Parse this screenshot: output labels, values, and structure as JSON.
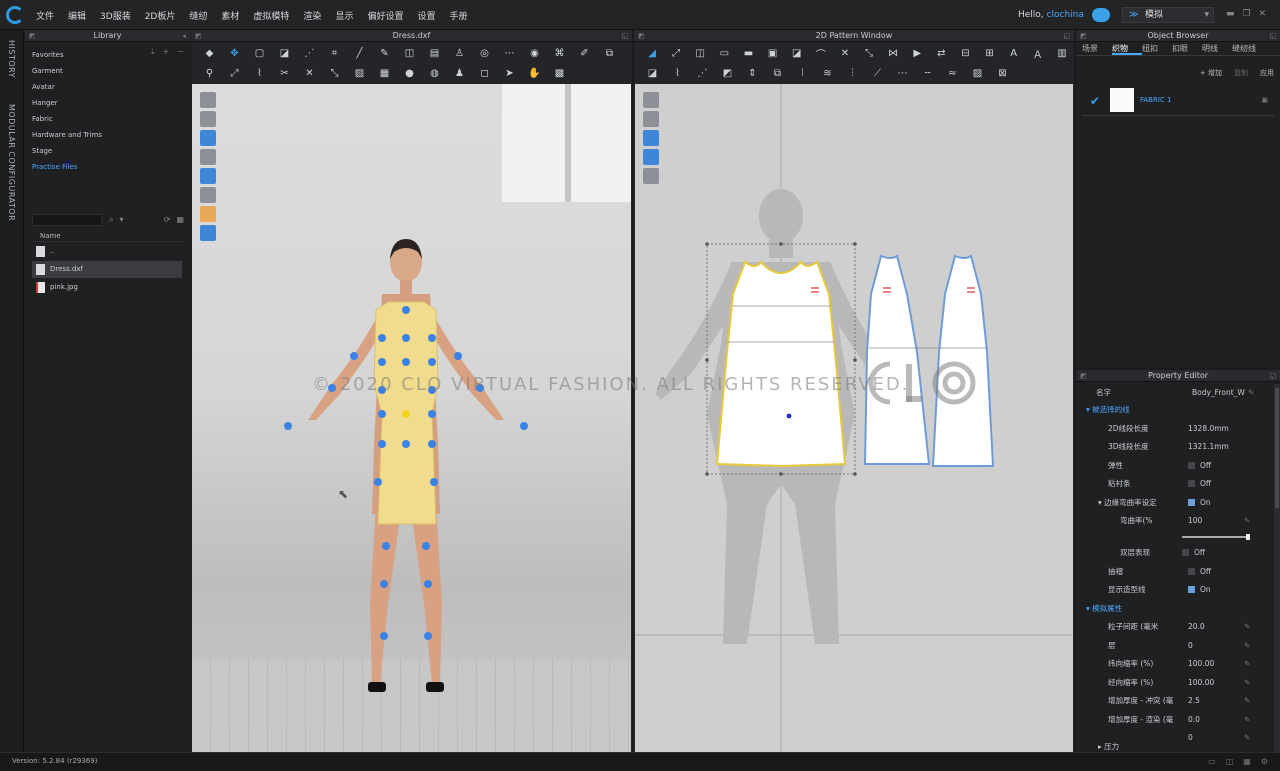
{
  "menu": [
    "文件",
    "编辑",
    "3D服装",
    "2D板片",
    "缝纫",
    "素材",
    "虚拟模特",
    "渲染",
    "显示",
    "偏好设置",
    "设置",
    "手册"
  ],
  "user": {
    "greeting": "Hello,",
    "name": "clochina"
  },
  "mode": "模拟",
  "vertical_tabs": [
    "HISTORY",
    "MODULAR CONFIGURATOR"
  ],
  "library": {
    "title": "Library",
    "categories": [
      "Favorites",
      "Garment",
      "Avatar",
      "Hanger",
      "Fabric",
      "Hardware and Trims",
      "Stage",
      "Practise Files"
    ],
    "active_category": "Practise Files",
    "column_header": "Name",
    "files": [
      "..",
      "Dress.dxf",
      "pink.jpg"
    ]
  },
  "window3d": {
    "title": "Dress.dxf"
  },
  "window2d": {
    "title": "2D Pattern Window"
  },
  "object_browser": {
    "title": "Object Browser",
    "tabs": [
      "场景",
      "织物",
      "纽扣",
      "扣眼",
      "明线",
      "缝纫线"
    ],
    "active_tab": "织物",
    "add": "+ 增加",
    "copy": "复制",
    "apply": "应用",
    "fabric_name": "FABRIC 1"
  },
  "property_editor": {
    "title": "Property Editor",
    "name_label": "名字",
    "name_value": "Body_Front_W",
    "section_selected": "被选择的线",
    "len2d_label": "2D线段长度",
    "len2d_value": "1328.0mm",
    "len3d_label": "3D线段长度",
    "len3d_value": "1321.1mm",
    "elastic_label": "弹性",
    "elastic_value": "Off",
    "tape_label": "粘衬条",
    "tape_value": "Off",
    "curve_label": "边缘弯曲率设定",
    "curve_value": "On",
    "curvature_label": "弯曲率(%",
    "curvature_value": "100",
    "double_label": "双层表现",
    "double_value": "Off",
    "gather_label": "抽褶",
    "gather_value": "Off",
    "display_label": "显示造型线",
    "display_value": "On",
    "section_sim": "模拟属性",
    "particle_label": "粒子间距 (毫米",
    "particle_value": "20.0",
    "layer_label": "层",
    "layer_value": "0",
    "weft_label": "纬向缩率 (%)",
    "weft_value": "100.00",
    "warp_label": "经向缩率 (%)",
    "warp_value": "100.00",
    "thick_col_label": "增加厚度 - 冲突 (毫",
    "thick_col_value": "2.5",
    "thick_ren_label": "增加厚度 - 渲染 (毫",
    "thick_ren_value": "0.0",
    "pressure_value": "0",
    "pressure_label": "压力"
  },
  "watermark": "© 2020 CLO VIRTUAL FASHION. ALL RIGHTS RESERVED.",
  "version": "Version: 5.2.84 (r29369)",
  "colors": {
    "accent": "#4aa8ff",
    "garment": "#f0dc8c",
    "points": "#3b82e6"
  }
}
